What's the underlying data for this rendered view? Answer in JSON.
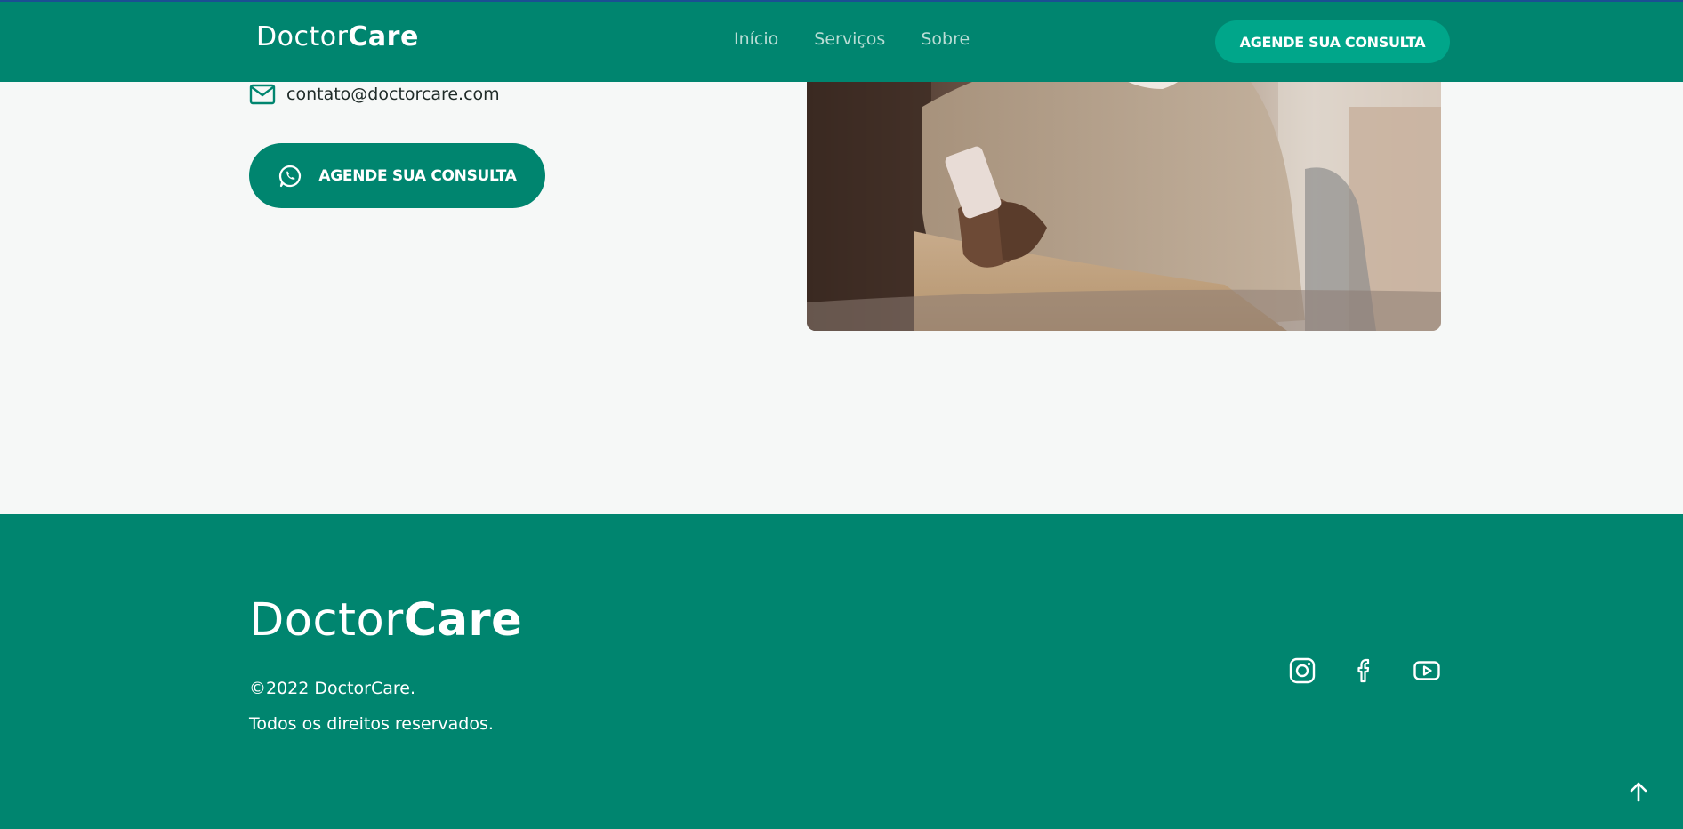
{
  "colors": {
    "primary": "#00856f",
    "button_accent": "#00a68a",
    "background": "#f6f8f7",
    "nav_link": "#b9ddd5",
    "text_dark": "#1f2b28"
  },
  "header": {
    "brand_part1": "Doctor",
    "brand_part2": "Care",
    "nav": [
      {
        "label": "Início"
      },
      {
        "label": "Serviços"
      },
      {
        "label": "Sobre"
      }
    ],
    "cta_label": "AGENDE SUA CONSULTA"
  },
  "contact": {
    "icon": "mail-icon",
    "email": "contato@doctorcare.com"
  },
  "cta": {
    "icon": "whatsapp-icon",
    "label": "AGENDE SUA CONSULTA"
  },
  "hero_image": {
    "subject": "person using smartphone"
  },
  "footer": {
    "brand_part1": "Doctor",
    "brand_part2": "Care",
    "copyright": "©2022 DoctorCare.",
    "rights": "Todos os direitos reservados.",
    "social": [
      {
        "icon": "instagram-icon"
      },
      {
        "icon": "facebook-icon"
      },
      {
        "icon": "youtube-icon"
      }
    ],
    "back_to_top_icon": "arrow-up-icon"
  }
}
